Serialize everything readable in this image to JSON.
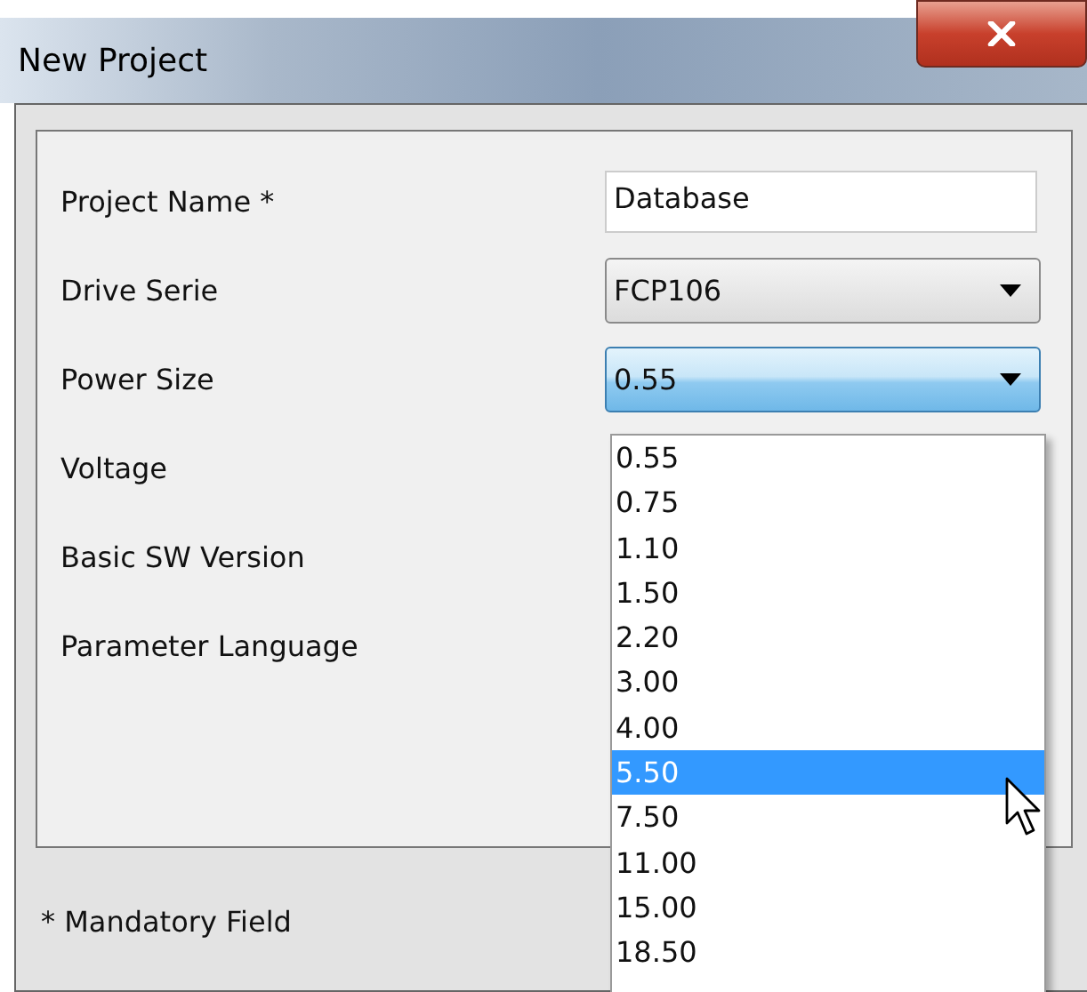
{
  "window": {
    "title": "New Project"
  },
  "fields": [
    {
      "label": "Project Name *",
      "kind": "text",
      "value": "Database"
    },
    {
      "label": "Drive Serie",
      "kind": "combo",
      "value": "FCP106",
      "focused": false
    },
    {
      "label": "Power Size",
      "kind": "combo",
      "value": "0.55",
      "focused": true
    },
    {
      "label": "Voltage",
      "kind": "covered"
    },
    {
      "label": "Basic SW Version",
      "kind": "covered"
    },
    {
      "label": "Parameter Language",
      "kind": "covered"
    }
  ],
  "dropdown": {
    "options": [
      {
        "label": "0.55",
        "selected": false
      },
      {
        "label": "0.75",
        "selected": false
      },
      {
        "label": "1.10",
        "selected": false
      },
      {
        "label": "1.50",
        "selected": false
      },
      {
        "label": "2.20",
        "selected": false
      },
      {
        "label": "3.00",
        "selected": false
      },
      {
        "label": "4.00",
        "selected": false
      },
      {
        "label": "5.50",
        "selected": true
      },
      {
        "label": "7.50",
        "selected": false
      },
      {
        "label": "11.00",
        "selected": false
      },
      {
        "label": "15.00",
        "selected": false
      },
      {
        "label": "18.50",
        "selected": false
      }
    ]
  },
  "footer": {
    "note": "* Mandatory Field"
  }
}
